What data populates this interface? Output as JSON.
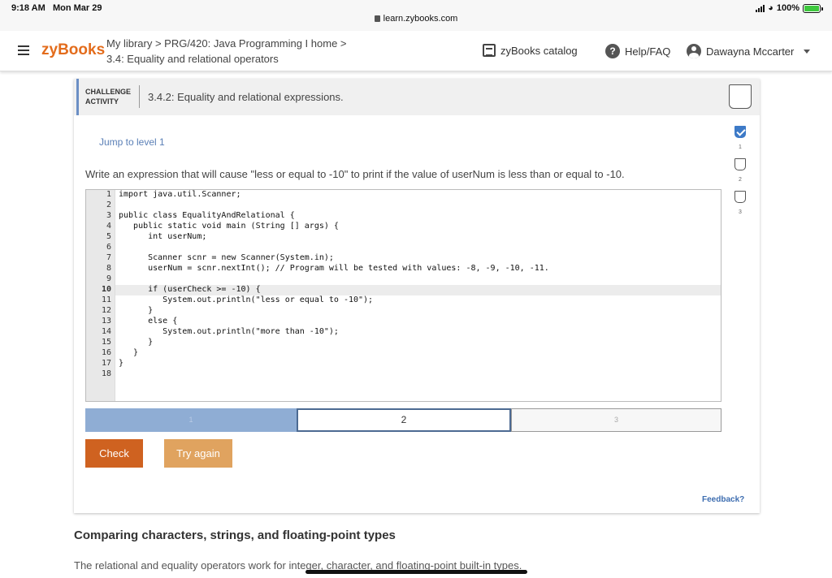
{
  "status_bar": {
    "time": "9:18 AM",
    "date": "Mon Mar 29",
    "battery": "100%"
  },
  "browser": {
    "url": "learn.zybooks.com"
  },
  "header": {
    "logo": "zyBooks",
    "breadcrumb_line1": "My library > PRG/420: Java Programming I home >",
    "breadcrumb_line2": "3.4: Equality and relational operators",
    "catalog_label": "zyBooks catalog",
    "help_label": "Help/FAQ",
    "user_name": "Dawayna Mccarter"
  },
  "activity": {
    "label_line1": "CHALLENGE",
    "label_line2": "ACTIVITY",
    "title": "3.4.2: Equality and relational expressions.",
    "jump_label": "Jump to level 1",
    "prompt": "Write an expression that will cause \"less or equal to -10\" to print if the value of userNum is less than or equal to -10.",
    "code_lines": [
      "import java.util.Scanner;",
      "",
      "public class EqualityAndRelational {",
      "   public static void main (String [] args) {",
      "      int userNum;",
      "",
      "      Scanner scnr = new Scanner(System.in);",
      "      userNum = scnr.nextInt(); // Program will be tested with values: -8, -9, -10, -11.",
      "",
      "      if (userCheck >= -10) {",
      "         System.out.println(\"less or equal to -10\");",
      "      }",
      "      else {",
      "         System.out.println(\"more than -10\");",
      "      }",
      "   }",
      "}",
      ""
    ],
    "line_numbers": [
      "1",
      "2",
      "3",
      "4",
      "5",
      "6",
      "7",
      "8",
      "9",
      "10",
      "11",
      "12",
      "13",
      "14",
      "15",
      "16",
      "17",
      "18"
    ],
    "levels": [
      "1",
      "2",
      "3"
    ],
    "current_level": 2,
    "check_label": "Check",
    "try_again_label": "Try again",
    "feedback_label": "Feedback?",
    "side_levels": [
      {
        "num": "1",
        "done": true
      },
      {
        "num": "2",
        "done": false
      },
      {
        "num": "3",
        "done": false
      }
    ]
  },
  "section": {
    "title": "Comparing characters, strings, and floating-point types",
    "text": "The relational and equality operators work for integer, character, and floating-point built-in types."
  },
  "colors": {
    "brand": "#e36c1c",
    "check_button": "#cf6220",
    "try_again_button": "#e0a35f",
    "level_done": "#3d7ac7"
  },
  "icons": [
    "hamburger-icon",
    "lock-icon",
    "catalog-icon",
    "help-icon",
    "user-icon",
    "chevron-down-icon",
    "check-icon"
  ]
}
